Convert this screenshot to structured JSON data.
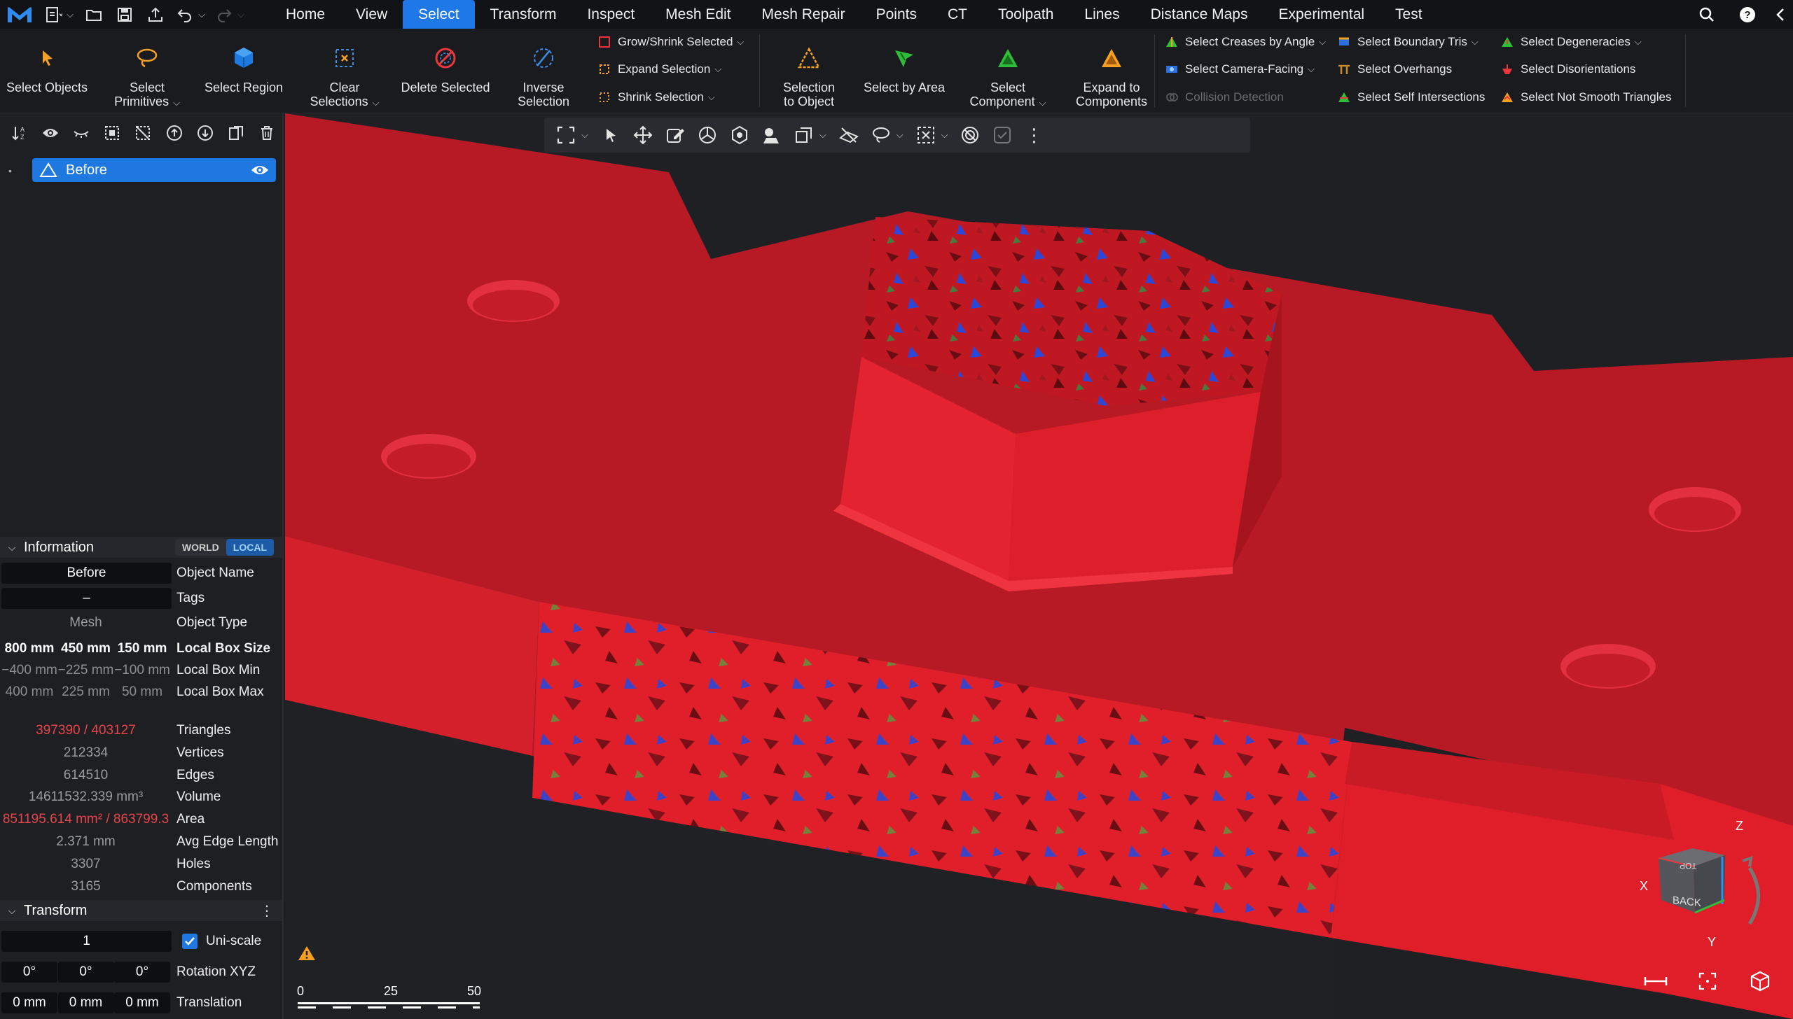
{
  "menu": {
    "tabs": [
      "Home",
      "View",
      "Select",
      "Transform",
      "Inspect",
      "Mesh Edit",
      "Mesh Repair",
      "Points",
      "CT",
      "Toolpath",
      "Lines",
      "Distance Maps",
      "Experimental",
      "Test"
    ],
    "active": "Select"
  },
  "ribbon": {
    "select_objects": "Select Objects",
    "select_primitives_1": "Select",
    "select_primitives_2": "Primitives",
    "select_region": "Select Region",
    "clear_sel_1": "Clear",
    "clear_sel_2": "Selections",
    "delete_selected": "Delete Selected",
    "inverse_1": "Inverse",
    "inverse_2": "Selection",
    "grow_shrink": "Grow/Shrink Selected",
    "expand_selection": "Expand Selection",
    "shrink_selection": "Shrink Selection",
    "sel_to_obj_1": "Selection",
    "sel_to_obj_2": "to Object",
    "select_by_area": "Select by Area",
    "select_component_1": "Select",
    "select_component_2": "Component",
    "expand_components_1": "Expand to",
    "expand_components_2": "Components",
    "creases": "Select Creases by Angle",
    "camera_facing": "Select Camera-Facing",
    "collision": "Collision Detection",
    "boundary_tris": "Select Boundary Tris",
    "overhangs": "Select Overhangs",
    "self_intersections": "Select Self Intersections",
    "degeneracies": "Select Degeneracies",
    "disorientations": "Select Disorientations",
    "not_smooth": "Select Not Smooth Triangles"
  },
  "scene": {
    "object_name": "Before"
  },
  "information": {
    "title": "Information",
    "world": "WORLD",
    "local": "LOCAL",
    "object_name_value": "Before",
    "object_name_label": "Object Name",
    "tags_value": "–",
    "tags_label": "Tags",
    "object_type_value": "Mesh",
    "object_type_label": "Object Type",
    "box_size": [
      "800 mm",
      "450 mm",
      "150 mm"
    ],
    "box_size_label": "Local Box Size",
    "box_min": [
      "−400 mm",
      "−225 mm",
      "−100 mm"
    ],
    "box_min_label": "Local Box Min",
    "box_max": [
      "400 mm",
      "225 mm",
      "50 mm"
    ],
    "box_max_label": "Local Box Max",
    "triangles_value": "397390 / 403127",
    "triangles_label": "Triangles",
    "vertices_value": "212334",
    "vertices_label": "Vertices",
    "edges_value": "614510",
    "edges_label": "Edges",
    "volume_value": "14611532.339 mm³",
    "volume_label": "Volume",
    "area_value": "851195.614 mm² / 863799.3",
    "area_label": "Area",
    "avg_edge_value": "2.371 mm",
    "avg_edge_label": "Avg Edge Length",
    "holes_value": "3307",
    "holes_label": "Holes",
    "components_value": "3165",
    "components_label": "Components"
  },
  "transform": {
    "title": "Transform",
    "scale_value": "1",
    "uniscale_label": "Uni-scale",
    "rotation": [
      "0°",
      "0°",
      "0°"
    ],
    "rotation_label": "Rotation XYZ",
    "translation": [
      "0 mm",
      "0 mm",
      "0 mm"
    ],
    "translation_label": "Translation"
  },
  "scale_bar": {
    "ticks": [
      "0",
      "25",
      "50"
    ]
  },
  "nav_cube": {
    "face_back": "BACK",
    "face_top": "TOP",
    "axis_x": "X",
    "axis_y": "Y",
    "axis_z": "Z"
  },
  "colors": {
    "accent": "#1e78e8",
    "mesh_red": "#e0202c",
    "selection_blue": "#2a50e0",
    "error_text": "#e5454a"
  }
}
